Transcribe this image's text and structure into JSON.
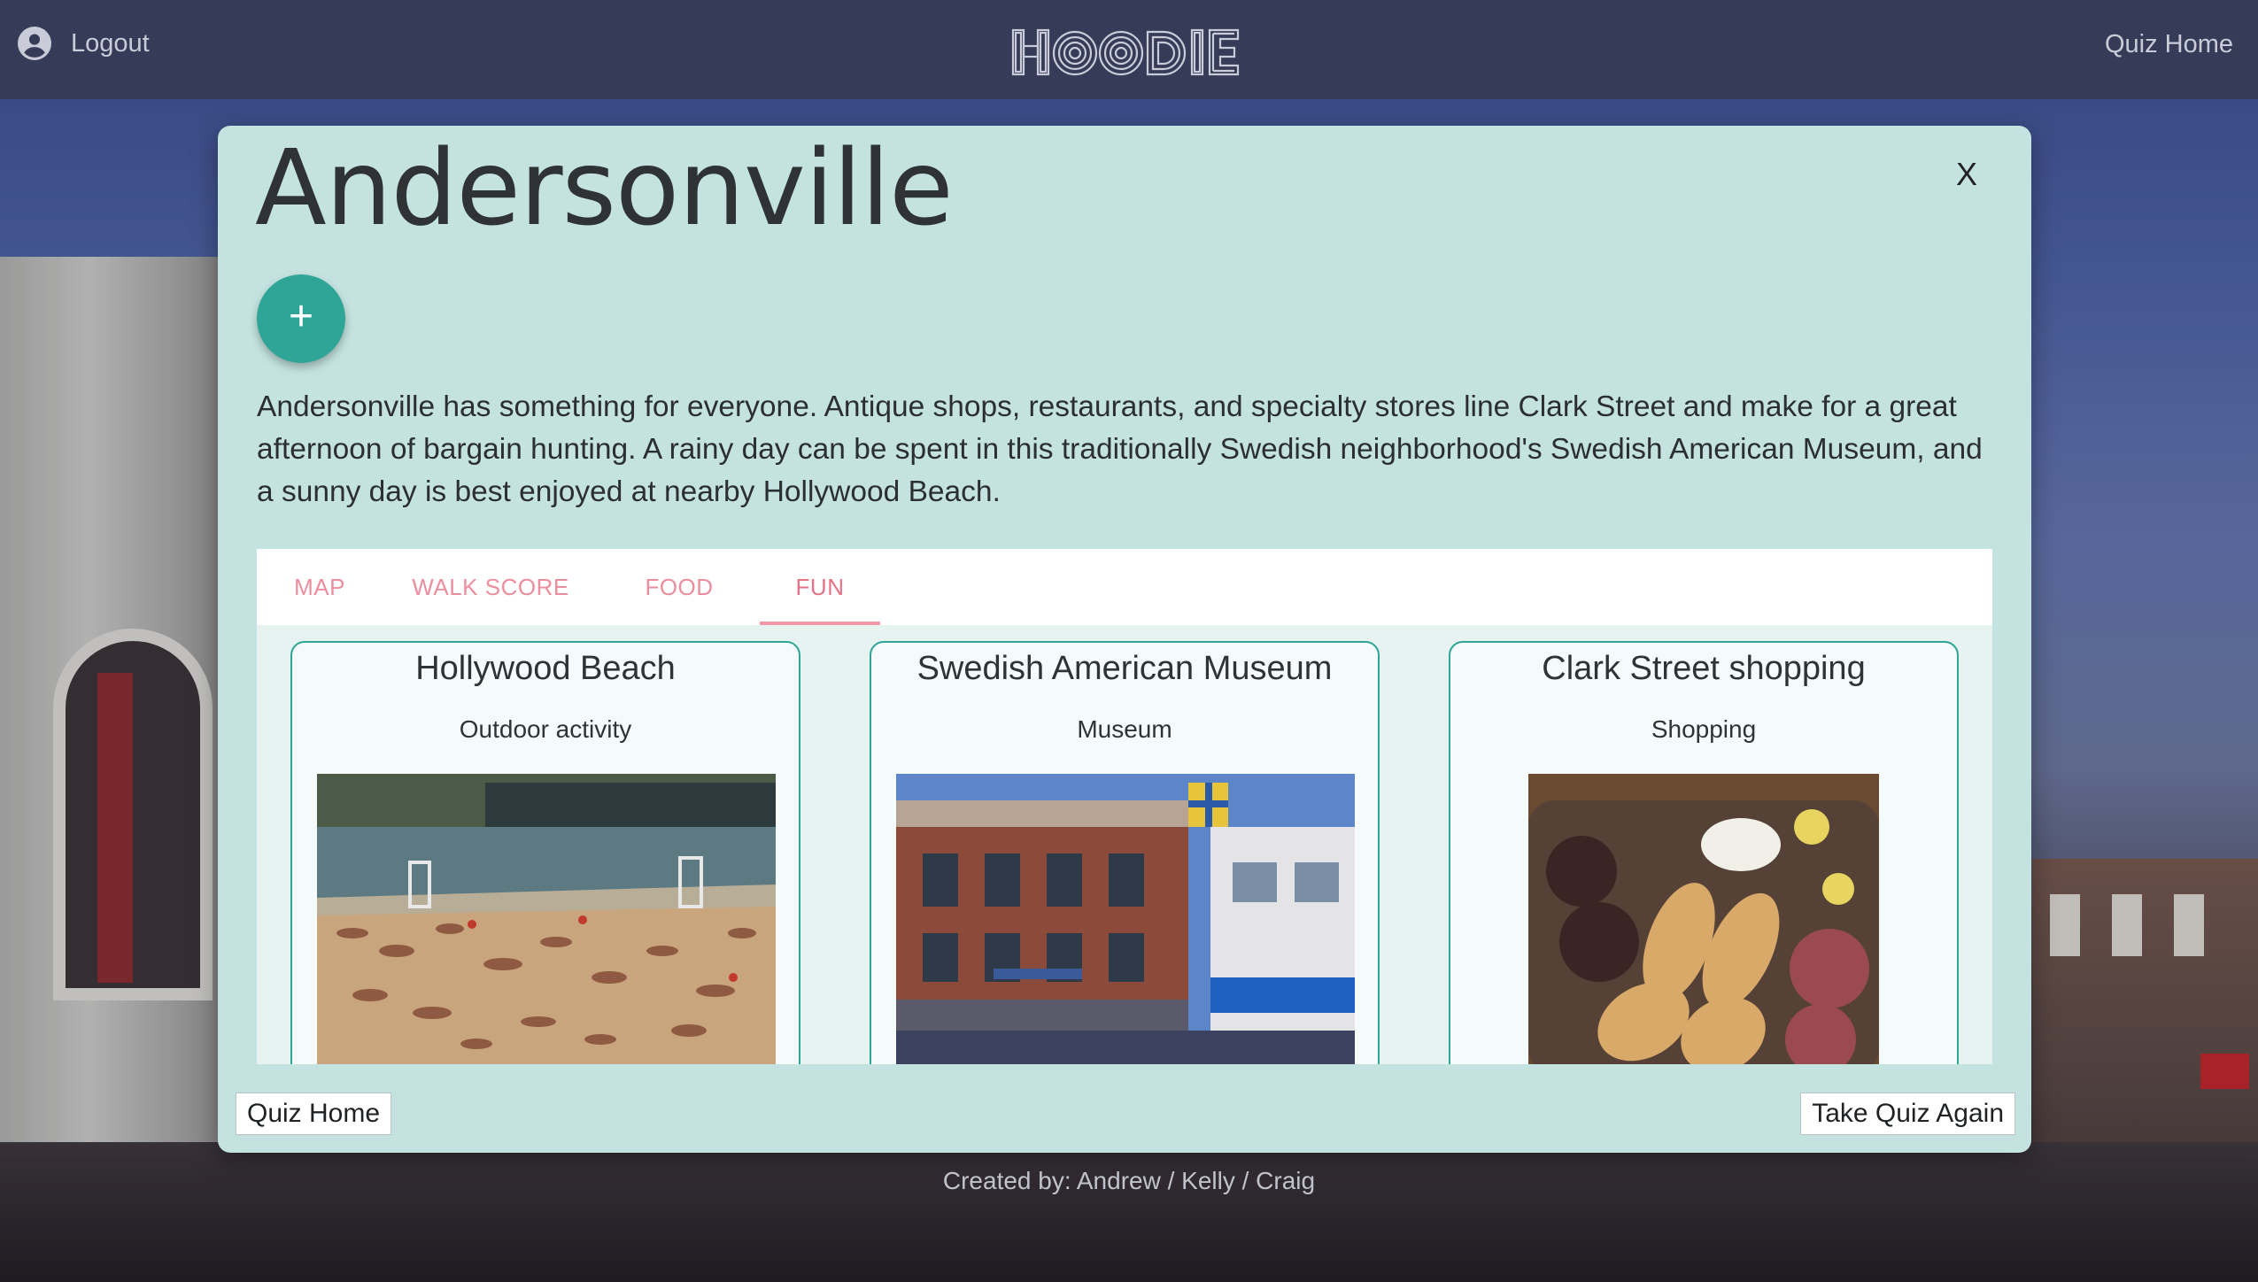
{
  "navbar": {
    "logout_label": "Logout",
    "logo_text": "HOODIE",
    "quiz_home_label": "Quiz Home",
    "account_icon": "account-circle-icon"
  },
  "modal": {
    "title": "Andersonville",
    "close_label": "X",
    "add_button_label": "+",
    "description": "Andersonville has something for everyone. Antique shops, restaurants, and specialty stores line Clark Street and make for a great afternoon of bargain hunting. A rainy day can be spent in this traditionally Swedish neighborhood's Swedish American Museum, and a sunny day is best enjoyed at nearby Hollywood Beach.",
    "tabs": [
      {
        "label": "MAP"
      },
      {
        "label": "WALK SCORE"
      },
      {
        "label": "FOOD"
      },
      {
        "label": "FUN",
        "active": true
      }
    ],
    "cards": [
      {
        "title": "Hollywood Beach",
        "subtitle": "Outdoor activity",
        "image": "beach-photo"
      },
      {
        "title": "Swedish American Museum",
        "subtitle": "Museum",
        "image": "museum-building-photo"
      },
      {
        "title": "Clark Street shopping",
        "subtitle": "Shopping",
        "image": "charcuterie-board-photo"
      }
    ],
    "quiz_home_button": "Quiz Home",
    "take_quiz_again_button": "Take Quiz Again"
  },
  "footer": {
    "credits": "Created by: Andrew / Kelly / Craig"
  },
  "colors": {
    "navbar_bg": "#363b58",
    "modal_bg": "#c4e3e0",
    "accent_teal": "#2ea597",
    "tab_pink": "#ec8e9e"
  }
}
